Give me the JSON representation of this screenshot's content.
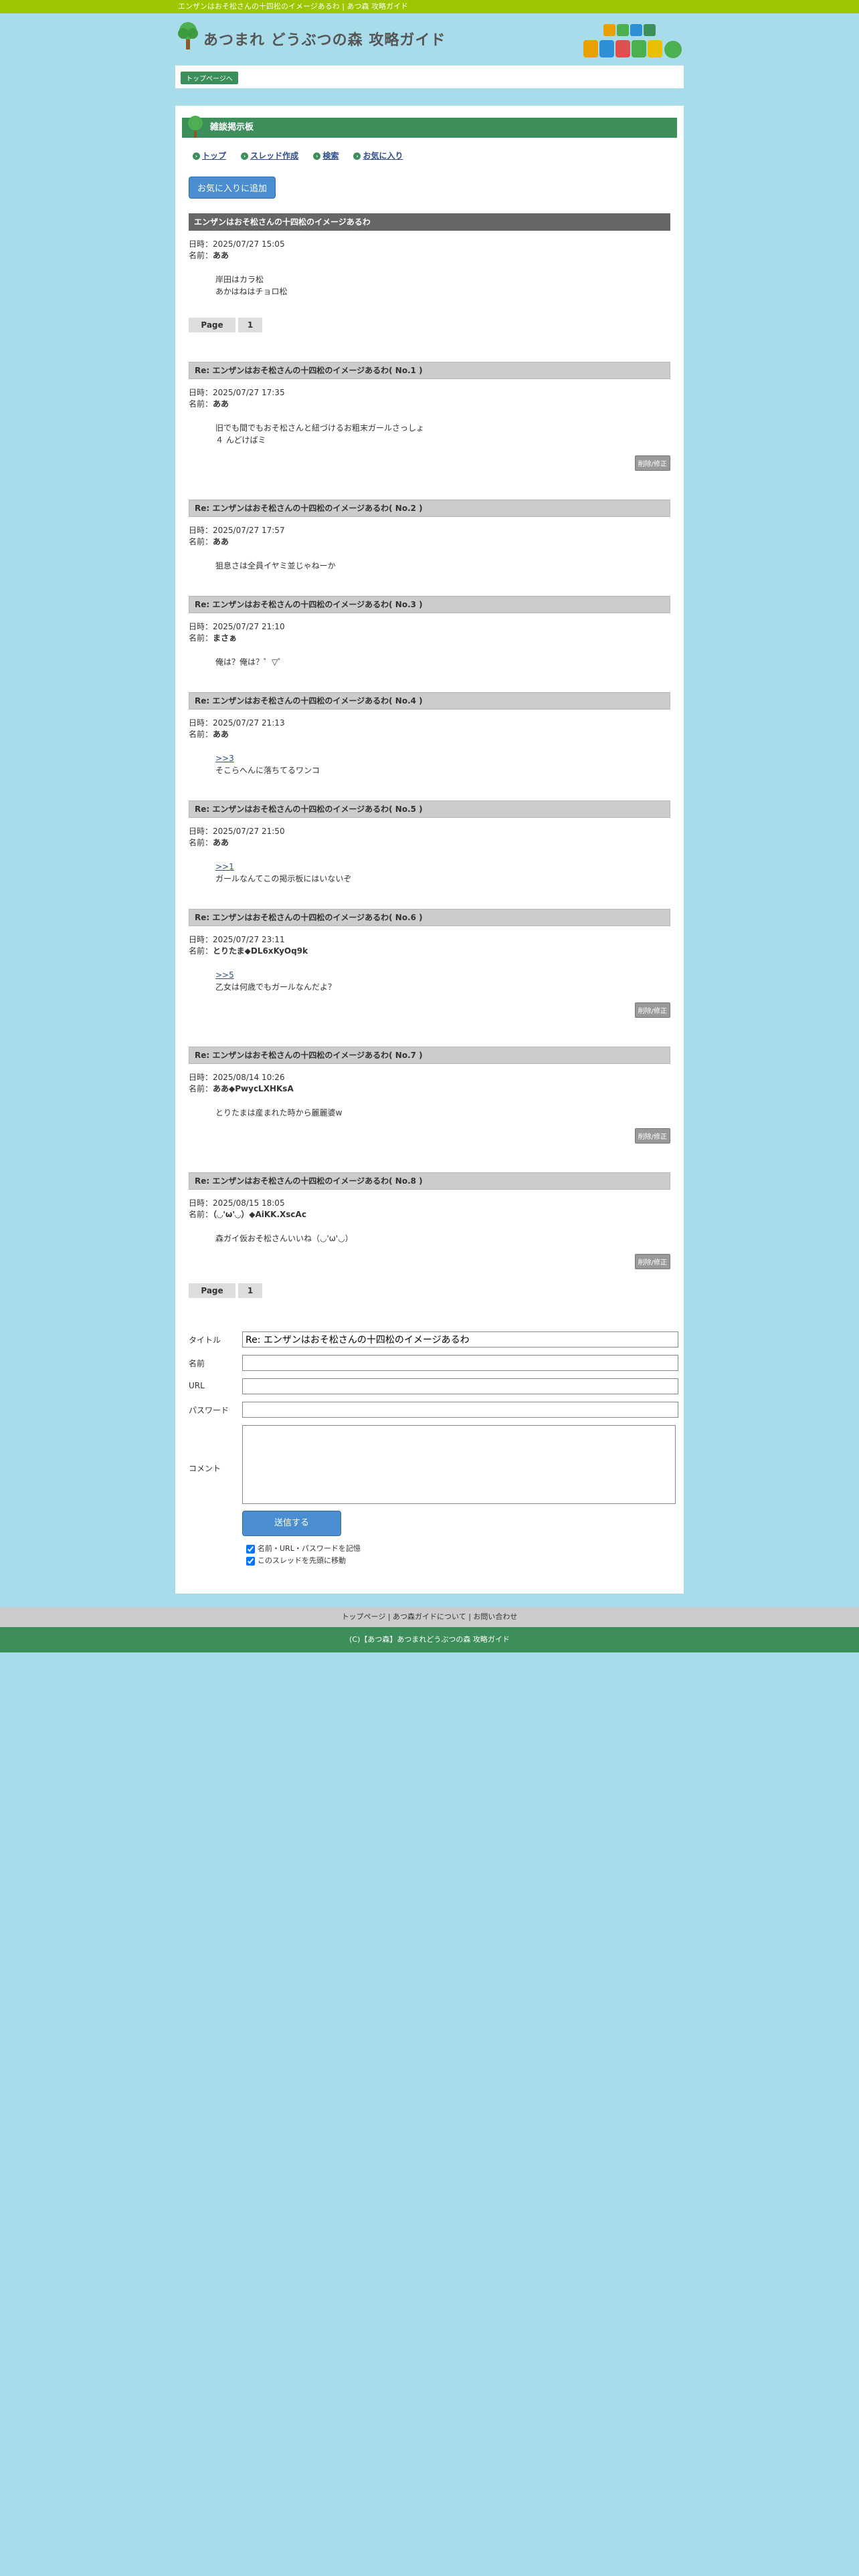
{
  "topbar": {
    "text": "エンザンはおそ松さんの十四松のイメージあるわ | あつ森 攻略ガイド"
  },
  "header": {
    "site_title": "あつまれ どうぶつの森 攻略ガイド",
    "badge_text": "あつまれ どうぶつの森"
  },
  "breadcrumb": {
    "label": "トップページへ"
  },
  "board": {
    "title": "雑談掲示板"
  },
  "nav": [
    {
      "label": "トップ"
    },
    {
      "label": "スレッド作成"
    },
    {
      "label": "検索"
    },
    {
      "label": "お気に入り"
    }
  ],
  "fav_button": "お気に入りに追加",
  "thread": {
    "title": "エンザンはおそ松さんの十四松のイメージあるわ",
    "date_label": "日時：",
    "name_label": "名前：",
    "date": "2025/07/27 15:05",
    "name": "ああ",
    "body_lines": [
      "岸田はカラ松",
      "あかはねはチョロ松"
    ]
  },
  "pager": {
    "label": "Page",
    "page": "1"
  },
  "delete_label": "削除/修正",
  "replies": [
    {
      "title": "Re: エンザンはおそ松さんの十四松のイメージあるわ( No.1 )",
      "date": "2025/07/27 17:35",
      "name": "ああ",
      "quote": "",
      "body_lines": [
        "旧でも間でもおそ松さんと紐づけるお粗末ガールさっしょ",
        "４ んどけばミ"
      ],
      "has_delete": true
    },
    {
      "title": "Re: エンザンはおそ松さんの十四松のイメージあるわ( No.2 )",
      "date": "2025/07/27 17:57",
      "name": "ああ",
      "quote": "",
      "body_lines": [
        "狙息さは全員イヤミ並じゃねーか"
      ],
      "has_delete": false
    },
    {
      "title": "Re: エンザンはおそ松さんの十四松のイメージあるわ( No.3 )",
      "date": "2025/07/27 21:10",
      "name": "まさぁ",
      "quote": "",
      "body_lines": [
        "俺は？俺は？゜▽゜"
      ],
      "has_delete": false
    },
    {
      "title": "Re: エンザンはおそ松さんの十四松のイメージあるわ( No.4 )",
      "date": "2025/07/27 21:13",
      "name": "ああ",
      "quote": ">>3",
      "body_lines": [
        "そこらへんに落ちてるワンコ"
      ],
      "has_delete": false
    },
    {
      "title": "Re: エンザンはおそ松さんの十四松のイメージあるわ( No.5 )",
      "date": "2025/07/27 21:50",
      "name": "ああ",
      "quote": ">>1",
      "body_lines": [
        "ガールなんてこの掲示板にはいないぞ"
      ],
      "has_delete": false
    },
    {
      "title": "Re: エンザンはおそ松さんの十四松のイメージあるわ( No.6 )",
      "date": "2025/07/27 23:11",
      "name": "とりたま◆DL6xKyOq9k",
      "quote": ">>5",
      "body_lines": [
        "乙女は何歳でもガールなんだよ？"
      ],
      "has_delete": true
    },
    {
      "title": "Re: エンザンはおそ松さんの十四松のイメージあるわ( No.7 )",
      "date": "2025/08/14 10:26",
      "name": "ああ◆PwycLXHKsA",
      "quote": "",
      "body_lines": [
        "とりたまは産まれた時から麗麗婆w"
      ],
      "has_delete": true
    },
    {
      "title": "Re: エンザンはおそ松さんの十四松のイメージあるわ( No.8 )",
      "date": "2025/08/15 18:05",
      "name": "（◡'ω'◡）◆AiKK.XscAc",
      "quote": "",
      "body_lines": [
        "森ガイ仮おそ松さんいいね（◡'ω'◡）"
      ],
      "has_delete": true
    }
  ],
  "form": {
    "title_label": "タイトル",
    "title_value": "Re: エンザンはおそ松さんの十四松のイメージあるわ",
    "name_label": "名前",
    "url_label": "URL",
    "password_label": "パスワード",
    "comment_label": "コメント",
    "submit_label": "送信する",
    "remember_label": "名前・URL・パスワードを記憶",
    "move_label": "このスレッドを先頭に移動"
  },
  "footer": {
    "links": [
      "トップページ",
      "あつ森ガイドについて",
      "お問い合わせ"
    ],
    "separator": " | ",
    "copyright": "(C)【あつ森】あつまれどうぶつの森 攻略ガイド"
  },
  "colors": {
    "accent_green": "#3c8f5a",
    "topbar_lime": "#9dc700",
    "background": "#a9dceb",
    "button_blue": "#4a8ed1"
  }
}
